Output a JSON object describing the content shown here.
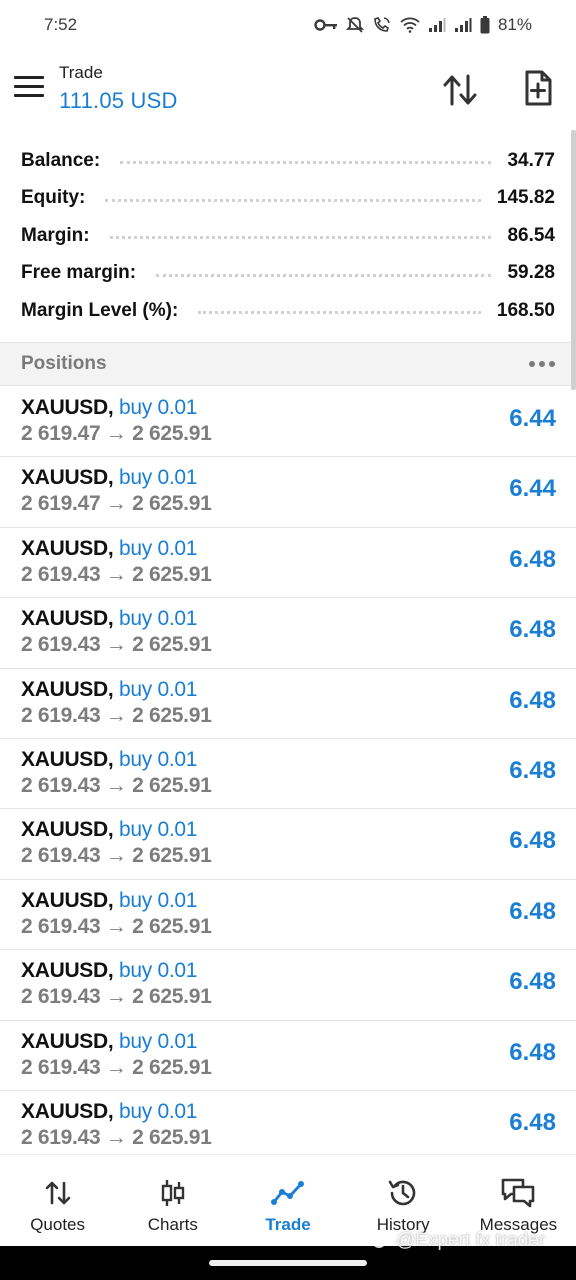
{
  "status_bar": {
    "time": "7:52",
    "battery": "81%"
  },
  "header": {
    "title": "Trade",
    "balance": "111.05 USD"
  },
  "summary": [
    {
      "label": "Balance:",
      "value": "34.77"
    },
    {
      "label": "Equity:",
      "value": "145.82"
    },
    {
      "label": "Margin:",
      "value": "86.54"
    },
    {
      "label": "Free margin:",
      "value": "59.28"
    },
    {
      "label": "Margin Level (%):",
      "value": "168.50"
    }
  ],
  "positions_title": "Positions",
  "positions": [
    {
      "symbol": "XAUUSD,",
      "side": "buy 0.01",
      "prices": "2 619.47 → 2 625.91",
      "profit": "6.44"
    },
    {
      "symbol": "XAUUSD,",
      "side": "buy 0.01",
      "prices": "2 619.47 → 2 625.91",
      "profit": "6.44"
    },
    {
      "symbol": "XAUUSD,",
      "side": "buy 0.01",
      "prices": "2 619.43 → 2 625.91",
      "profit": "6.48"
    },
    {
      "symbol": "XAUUSD,",
      "side": "buy 0.01",
      "prices": "2 619.43 → 2 625.91",
      "profit": "6.48"
    },
    {
      "symbol": "XAUUSD,",
      "side": "buy 0.01",
      "prices": "2 619.43 → 2 625.91",
      "profit": "6.48"
    },
    {
      "symbol": "XAUUSD,",
      "side": "buy 0.01",
      "prices": "2 619.43 → 2 625.91",
      "profit": "6.48"
    },
    {
      "symbol": "XAUUSD,",
      "side": "buy 0.01",
      "prices": "2 619.43 → 2 625.91",
      "profit": "6.48"
    },
    {
      "symbol": "XAUUSD,",
      "side": "buy 0.01",
      "prices": "2 619.43 → 2 625.91",
      "profit": "6.48"
    },
    {
      "symbol": "XAUUSD,",
      "side": "buy 0.01",
      "prices": "2 619.43 → 2 625.91",
      "profit": "6.48"
    },
    {
      "symbol": "XAUUSD,",
      "side": "buy 0.01",
      "prices": "2 619.43 → 2 625.91",
      "profit": "6.48"
    },
    {
      "symbol": "XAUUSD,",
      "side": "buy 0.01",
      "prices": "2 619.43 → 2 625.91",
      "profit": "6.48"
    }
  ],
  "bottom_nav": [
    {
      "label": "Quotes",
      "icon": "quotes-icon",
      "active": false
    },
    {
      "label": "Charts",
      "icon": "charts-icon",
      "active": false
    },
    {
      "label": "Trade",
      "icon": "trade-icon",
      "active": true
    },
    {
      "label": "History",
      "icon": "history-icon",
      "active": false
    },
    {
      "label": "Messages",
      "icon": "messages-icon",
      "active": false
    }
  ],
  "watermark": "@Expert fx trader",
  "colors": {
    "accent": "#1a7fd4",
    "muted": "#7d7d7d"
  }
}
